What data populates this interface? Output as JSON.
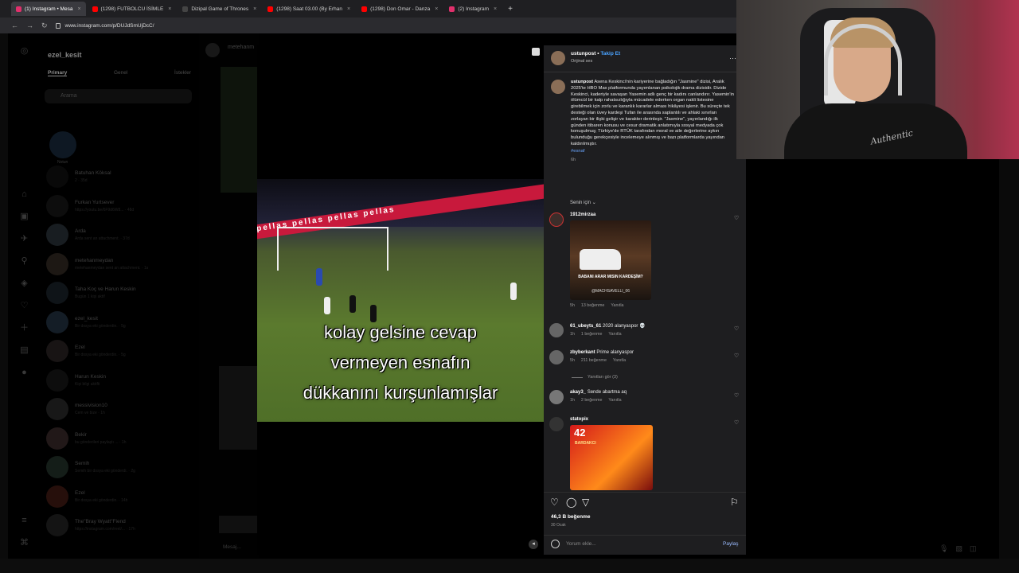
{
  "browser": {
    "tabs": [
      {
        "label": "(1) Instagram • Mesa",
        "color": "#e1306c",
        "active": true
      },
      {
        "label": "(1298) FUTBOLCU İSİMLE",
        "color": "#ff0000",
        "active": false
      },
      {
        "label": "Dizipal Game of Thrones",
        "color": "#444444",
        "active": false
      },
      {
        "label": "(1298) Saat 03.00 (By Erhan",
        "color": "#ff0000",
        "active": false
      },
      {
        "label": "(1298) Don Omar - Danza",
        "color": "#ff0000",
        "active": false
      },
      {
        "label": "(2) Instagram",
        "color": "#e1306c",
        "active": false
      }
    ],
    "url": "www.instagram.com/p/DUJdSmUjDcC/"
  },
  "dm": {
    "username": "ezel_kesit",
    "tabs": [
      "Primary",
      "Genel",
      "İstekler"
    ],
    "search_placeholder": "Arama",
    "note_label": "Notun",
    "conversations": [
      {
        "name": "Batuhan Köksal",
        "preview": "2 · 35d"
      },
      {
        "name": "Furkan Yurtsever",
        "preview": "https://youtu.be/6F9d6W8... · 48d"
      },
      {
        "name": "Arda",
        "preview": "Arda sent an attachment. · 37d"
      },
      {
        "name": "metehanmeydan",
        "preview": "metehanmeydan sent an attachment. · 1s"
      },
      {
        "name": "Taha Koç ve Harun Keskin",
        "preview": "Bugün 1 kişi aktif"
      },
      {
        "name": "ezel_kesit",
        "preview": "Bir dosya eki gönderdin. · 5g"
      },
      {
        "name": "Ezel",
        "preview": "Bir dosya eki gönderdin. · 5g"
      },
      {
        "name": "Harun Keskin",
        "preview": "Kişi bilgi aktifti"
      },
      {
        "name": "messivision10",
        "preview": "Cem ve bize · 1h"
      },
      {
        "name": "Bekir",
        "preview": "bu gönderileri paylaştı ... · 1h"
      },
      {
        "name": "Semih",
        "preview": "Semih bir dosya eki gönderdi. · 2g"
      },
      {
        "name": "Ezel",
        "preview": "Bir dosya eki gönderdin. · 14h"
      },
      {
        "name": "The\"Bray Wyatt\"Fiend",
        "preview": "https://instagram.com/reel/... · 17h"
      }
    ],
    "message_placeholder": "Mesaj..."
  },
  "chat_header": {
    "name": "metehanm"
  },
  "post": {
    "caption_overlay": [
      "kolay gelsine cevap",
      "vermeyen esnafın",
      "dükkanını kurşunlamışlar"
    ],
    "ad_text": "pellas pellas pellas pellas",
    "author": "ustunpost",
    "follow": "Takip Et",
    "audio": "Orijinal ses",
    "caption": "Asena Keskinci'nin kariyerine bağladığın \"Jasmine\" dizisi, Aralık 2025'te HBO Max platformunda yayımlanan psikolojik drama dizisidir. Dizide Keskinci, kaderiyle savaşan Yasemin adlı genç bir kadını canlandırır. Yasemin'in ölümcül bir kalp rahatsızlığıyla mücadele ederken organ nakli listesine girebilmek için zorlu ve karanlık kararlar alması hikâyesi işlenir. Bu süreçte tek desteği olan üvey kardeşi Tufan ile arasında saplantılı ve ahlaki sınırları zorlayan bir ilişki gelişir ve karakter derinleşir. \"Jasmine\", yayınlandığı ilk günden itibaren konusu ve cesur dramatik anlatımıyla sosyal medyada çok konuşulmuş; Türkiye'de RTÜK tarafından moral ve aile değerlerine aykırı bulunduğu gerekçesiyle incelemeye alınmış ve bazı platformlarda yayından kaldırılmıştır.",
    "hashtag": "#esnaf",
    "age": "6h",
    "for_you": "Senin için",
    "likes": "46,3 B beğenme",
    "date": "30 Ocak",
    "comment_placeholder": "Yorum ekle...",
    "share": "Paylaş"
  },
  "comments": [
    {
      "user": "1912mirzaa",
      "text": "",
      "meta": [
        "5h",
        "13 beğenme",
        "Yanıtla"
      ],
      "image_text": "BABANI ARAR MISIN KARDEŞİM?",
      "image_handle": "@MACHSAVELLI_06"
    },
    {
      "user": "61_ubeyts_61",
      "text": "2020 alanyaspor 💀",
      "meta": [
        "1h",
        "1 beğenme",
        "Yanıtla"
      ]
    },
    {
      "user": "zbyberkant",
      "text": "Prime alanyaspor",
      "meta": [
        "5h",
        "211 beğenme",
        "Yanıtla"
      ]
    },
    {
      "user": "akay3_",
      "text": "Sende abartma aq",
      "meta": [
        "1h",
        "2 beğenme",
        "Yanıtla"
      ]
    },
    {
      "user": "statopix",
      "text": "",
      "image_number": "42",
      "image_name": "BARDAKCI"
    }
  ],
  "replies_label": "Yanıtları gör (3)",
  "webcam": {
    "logo": "Authentic"
  }
}
